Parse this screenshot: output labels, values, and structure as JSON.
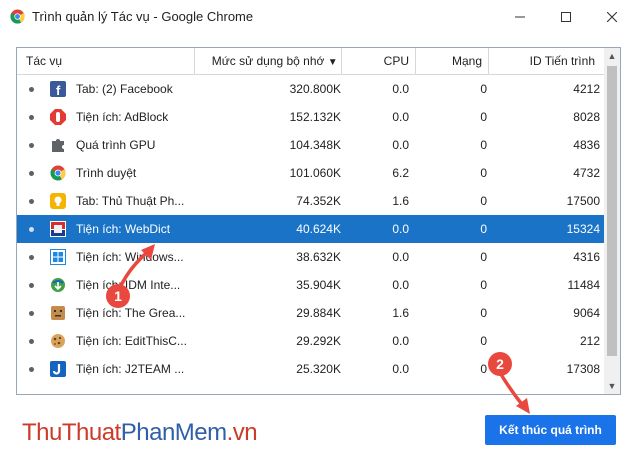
{
  "window": {
    "title": "Trình quản lý Tác vụ - Google Chrome"
  },
  "columns": {
    "task": "Tác vụ",
    "memory": "Mức sử dụng bộ nhớ",
    "cpu": "CPU",
    "network": "Mạng",
    "pid": "ID Tiến trình"
  },
  "rows": [
    {
      "name": "Tab: (2) Facebook",
      "memory": "320.800K",
      "cpu": "0.0",
      "network": "0",
      "pid": "4212",
      "icon": "facebook-icon"
    },
    {
      "name": "Tiện ích: AdBlock",
      "memory": "152.132K",
      "cpu": "0.0",
      "network": "0",
      "pid": "8028",
      "icon": "adblock-icon"
    },
    {
      "name": "Quá trình GPU",
      "memory": "104.348K",
      "cpu": "0.0",
      "network": "0",
      "pid": "4836",
      "icon": "puzzle-icon"
    },
    {
      "name": "Trình duyệt",
      "memory": "101.060K",
      "cpu": "6.2",
      "network": "0",
      "pid": "4732",
      "icon": "chrome-icon"
    },
    {
      "name": "Tab: Thủ Thuật Ph...",
      "memory": "74.352K",
      "cpu": "1.6",
      "network": "0",
      "pid": "17500",
      "icon": "lightbulb-icon"
    },
    {
      "name": "Tiện ích: WebDict",
      "memory": "40.624K",
      "cpu": "0.0",
      "network": "0",
      "pid": "15324",
      "icon": "webdict-icon"
    },
    {
      "name": "Tiện ích: Windows...",
      "memory": "38.632K",
      "cpu": "0.0",
      "network": "0",
      "pid": "4316",
      "icon": "windows-icon"
    },
    {
      "name": "Tiện ích: IDM Inte...",
      "memory": "35.904K",
      "cpu": "0.0",
      "network": "0",
      "pid": "11484",
      "icon": "idm-icon"
    },
    {
      "name": "Tiện ích: The Grea...",
      "memory": "29.884K",
      "cpu": "1.6",
      "network": "0",
      "pid": "9064",
      "icon": "great-suspender-icon"
    },
    {
      "name": "Tiện ích: EditThisC...",
      "memory": "29.292K",
      "cpu": "0.0",
      "network": "0",
      "pid": "212",
      "icon": "cookie-icon"
    },
    {
      "name": "Tiện ích: J2TEAM ...",
      "memory": "25.320K",
      "cpu": "0.0",
      "network": "0",
      "pid": "17308",
      "icon": "j2team-icon"
    }
  ],
  "selected_row_index": 5,
  "end_process_button": "Kết thúc quá trình",
  "watermark": {
    "part1": "ThuThuat",
    "part2": "PhanMem",
    "part3": ".vn"
  },
  "annotations": {
    "step1": "1",
    "step2": "2"
  },
  "colors": {
    "selection": "#1a73c7",
    "button": "#1a73e8",
    "annotation": "#e8483d"
  }
}
